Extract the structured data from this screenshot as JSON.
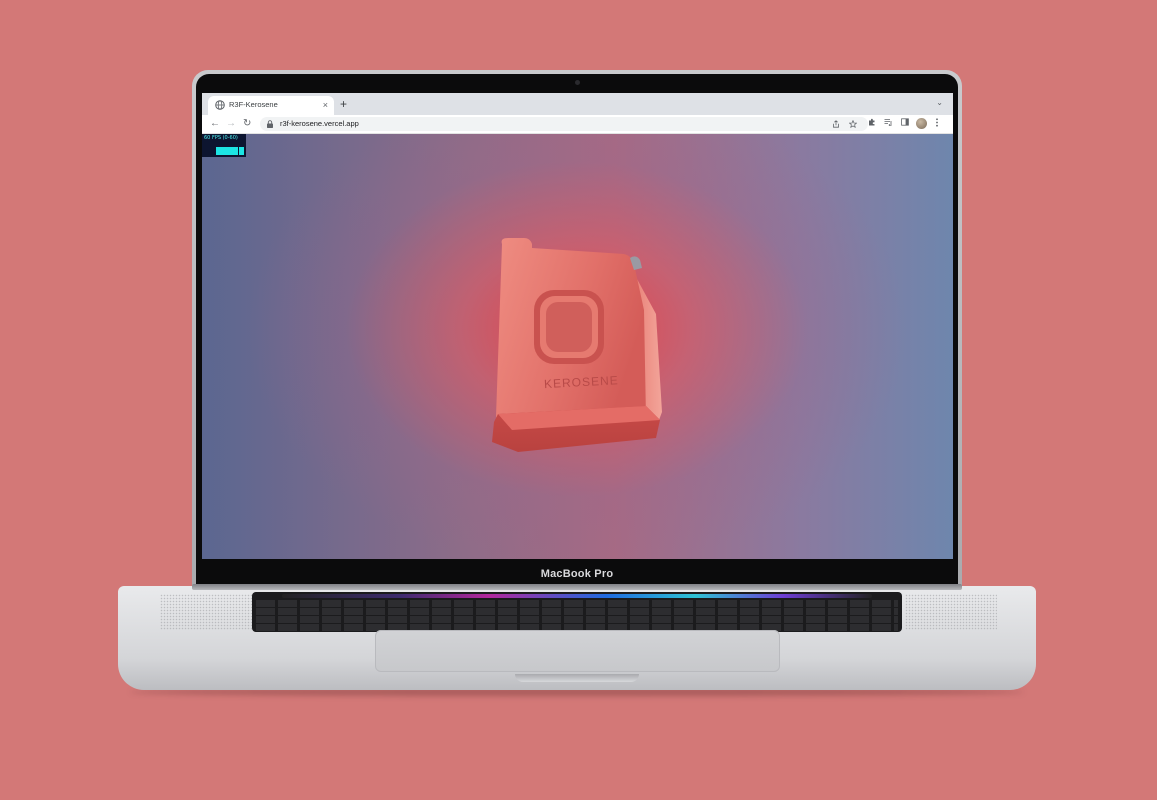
{
  "colors": {
    "background": "#d37877",
    "viewport_center": "#e84246",
    "viewport_edge": "#5b6791",
    "can_body": "#de6e66",
    "stats_text": "#4ff3f2"
  },
  "browser": {
    "tab": {
      "favicon": "globe-icon",
      "title": "R3F-Kerosene",
      "close_label": "×"
    },
    "new_tab_label": "+",
    "tab_menu_label": "⌄",
    "nav": {
      "back_label": "←",
      "forward_label": "→",
      "reload_label": "↻"
    },
    "address": {
      "lock_icon": "lock-icon",
      "url": "r3f-kerosene.vercel.app"
    },
    "toolbar_icons": [
      "share-icon",
      "star-icon",
      "puzzle-icon",
      "media-queue-icon",
      "sidepanel-icon",
      "profile-avatar",
      "kebab-menu-icon"
    ]
  },
  "page": {
    "stats_label": "60 FPS (0-60)",
    "product_label": "KEROSENE"
  },
  "device": {
    "model_label": "MacBook Pro"
  }
}
